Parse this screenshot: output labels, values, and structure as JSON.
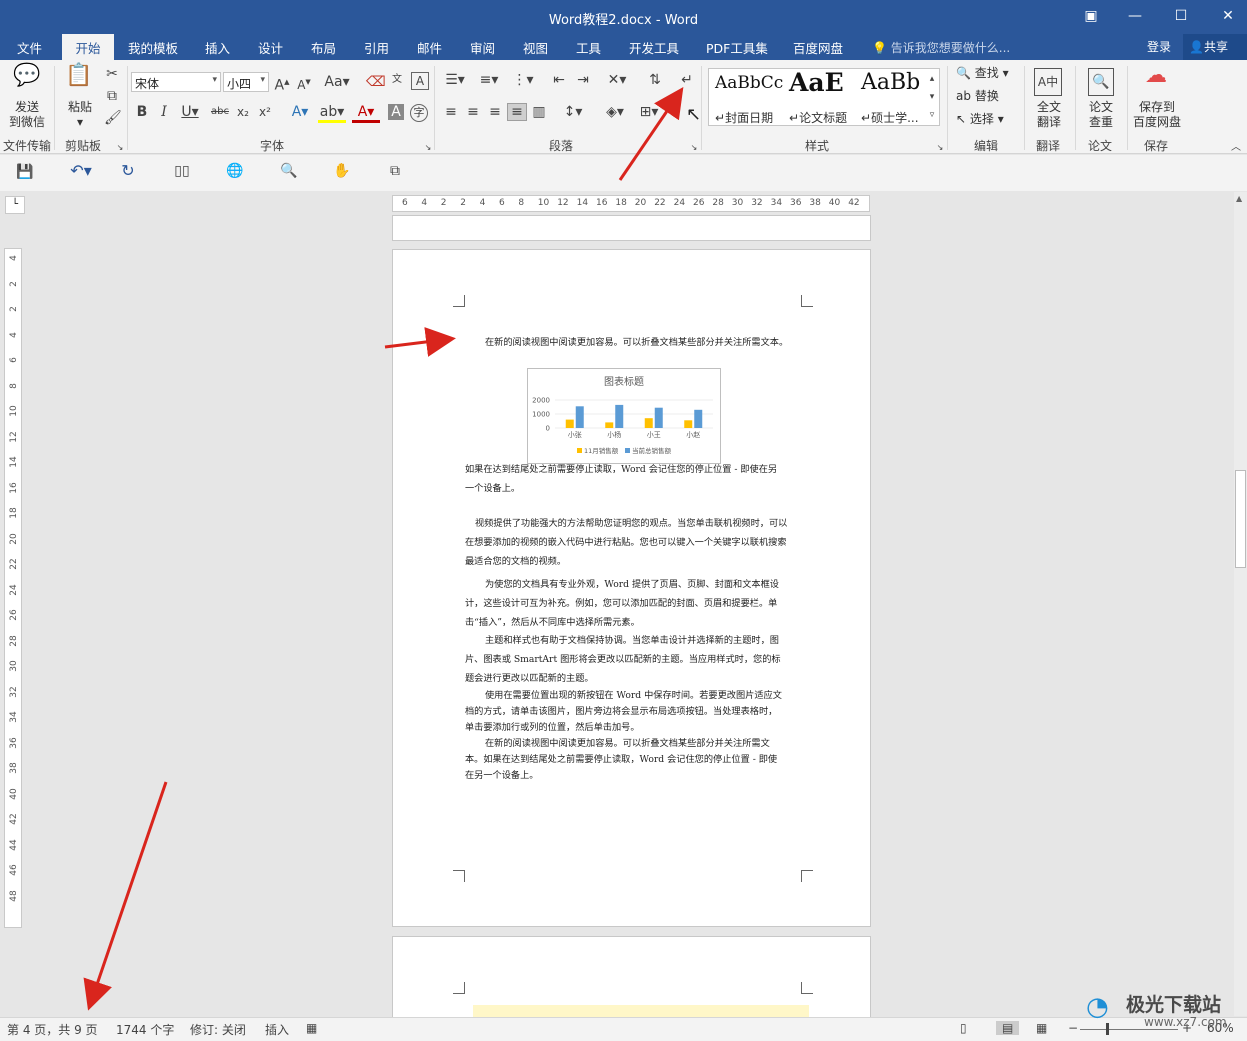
{
  "window": {
    "title": "Word教程2.docx - Word"
  },
  "menu": {
    "tabs": [
      {
        "label": "文件"
      },
      {
        "label": "开始"
      },
      {
        "label": "我的模板"
      },
      {
        "label": "插入"
      },
      {
        "label": "设计"
      },
      {
        "label": "布局"
      },
      {
        "label": "引用"
      },
      {
        "label": "邮件"
      },
      {
        "label": "审阅"
      },
      {
        "label": "视图"
      },
      {
        "label": "工具"
      },
      {
        "label": "开发工具"
      },
      {
        "label": "PDF工具集"
      },
      {
        "label": "百度网盘"
      }
    ],
    "active_tab": "开始",
    "tell_me": "告诉我您想要做什么...",
    "login": "登录",
    "share": "共享"
  },
  "ribbon": {
    "send": {
      "label1": "发送",
      "label2": "到微信",
      "group": "文件传输"
    },
    "clipboard": {
      "paste": "粘贴",
      "group": "剪贴板"
    },
    "font": {
      "name": "宋体",
      "size": "小四",
      "group": "字体"
    },
    "paragraph": {
      "group": "段落"
    },
    "styles": {
      "group": "样式",
      "items": [
        {
          "sample": "AaBbCc",
          "name": "封面日期"
        },
        {
          "sample": "AaE",
          "name": "论文标题"
        },
        {
          "sample": "AaBb",
          "name": "硕士学..."
        }
      ]
    },
    "editing": {
      "find": "查找",
      "replace": "替换",
      "select": "选择",
      "group": "编辑"
    },
    "translate": {
      "label1": "全文",
      "label2": "翻译",
      "group": "翻译"
    },
    "thesis": {
      "label1": "论文",
      "label2": "查重",
      "group": "论文"
    },
    "save": {
      "label1": "保存到",
      "label2": "百度网盘",
      "group": "保存"
    }
  },
  "ruler": {
    "h_ticks": [
      "6",
      "4",
      "2",
      "2",
      "4",
      "6",
      "8",
      "10",
      "12",
      "14",
      "16",
      "18",
      "20",
      "22",
      "24",
      "26",
      "28",
      "30",
      "32",
      "34",
      "36",
      "38",
      "40",
      "42"
    ],
    "v_ticks": [
      "4",
      "2",
      "2",
      "4",
      "6",
      "8",
      "10",
      "12",
      "14",
      "16",
      "18",
      "20",
      "22",
      "24",
      "26",
      "28",
      "30",
      "32",
      "34",
      "36",
      "38",
      "40",
      "42",
      "44",
      "46",
      "48"
    ]
  },
  "document": {
    "line1": "在新的阅读视图中阅读更加容易。可以折叠文档某些部分并关注所需文本。",
    "chart": {
      "title": "图表标题",
      "legend": [
        "11月销售额",
        "当前总销售额"
      ]
    },
    "para1": [
      "如果在达到结尾处之前需要停止读取，Word 会记住您的停止位置 - 即使在另",
      "一个设备上。"
    ],
    "para2": [
      "视频提供了功能强大的方法帮助您证明您的观点。当您单击联机视频时，可以",
      "在想要添加的视频的嵌入代码中进行粘贴。您也可以键入一个关键字以联机搜索",
      "最适合您的文档的视频。"
    ],
    "para3": [
      "为使您的文档具有专业外观，Word 提供了页眉、页脚、封面和文本框设",
      "计，这些设计可互为补充。例如，您可以添加匹配的封面、页眉和提要栏。单",
      "击“插入”，然后从不同库中选择所需元素。"
    ],
    "para4": [
      "主题和样式也有助于文档保持协调。当您单击设计并选择新的主题时，图",
      "片、图表或 SmartArt 图形将会更改以匹配新的主题。当应用样式时，您的标",
      "题会进行更改以匹配新的主题。"
    ],
    "para5": [
      "使用在需要位置出现的新按钮在 Word 中保存时间。若要更改图片适应文",
      "档的方式，请单击该图片，图片旁边将会显示布局选项按钮。当处理表格时，",
      "单击要添加行或列的位置，然后单击加号。"
    ],
    "para6": [
      "在新的阅读视图中阅读更加容易。可以折叠文档某些部分并关注所需文",
      "本。如果在达到结尾处之前需要停止读取，Word 会记住您的停止位置 - 即使",
      "在另一个设备上。"
    ]
  },
  "chart_data": {
    "type": "bar",
    "title": "图表标题",
    "categories": [
      "小张",
      "小杨",
      "小王",
      "小赵"
    ],
    "series": [
      {
        "name": "11月销售额",
        "values": [
          600,
          400,
          700,
          550
        ],
        "color": "#ffc000"
      },
      {
        "name": "当前总销售额",
        "values": [
          1550,
          1650,
          1450,
          1300
        ],
        "color": "#5b9bd5"
      }
    ],
    "yticks": [
      "2000",
      "1000",
      "0"
    ],
    "ylim": [
      0,
      2000
    ]
  },
  "status": {
    "page": "第 4 页，共 9 页",
    "words": "1744 个字",
    "track": "修订: 关闭",
    "mode": "插入",
    "zoom": "60%"
  },
  "watermark": {
    "text1": "极光下载站",
    "text2": "www.xz7.com"
  },
  "colors": {
    "brand": "#2b579a",
    "arrow": "#d9251d"
  }
}
